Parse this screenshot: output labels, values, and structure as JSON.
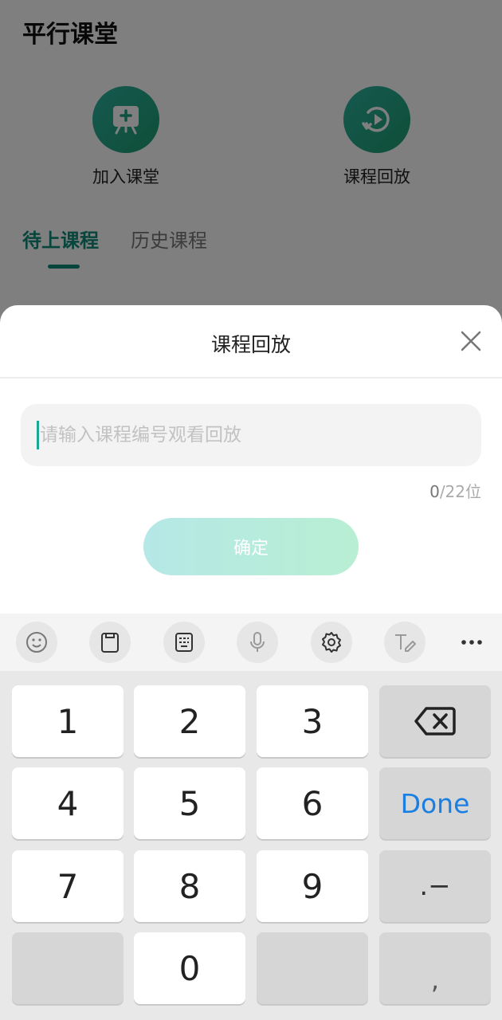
{
  "app": {
    "title": "平行课堂"
  },
  "actions": [
    {
      "label": "加入课堂",
      "icon": "join-class-icon"
    },
    {
      "label": "课程回放",
      "icon": "replay-icon"
    }
  ],
  "tabs": [
    {
      "label": "待上课程",
      "active": true
    },
    {
      "label": "历史课程",
      "active": false
    }
  ],
  "sheet": {
    "title": "课程回放",
    "close_icon": "close-icon",
    "input": {
      "value": "",
      "placeholder": "请输入课程编号观看回放"
    },
    "counter": {
      "current": "0",
      "suffix": "/22位"
    },
    "confirm_label": "确定"
  },
  "keyboard": {
    "toolbar": [
      "emoji-icon",
      "clipboard-icon",
      "keyboard-layout-icon",
      "microphone-icon",
      "settings-icon",
      "handwriting-icon",
      "more-icon"
    ],
    "keys": {
      "k1": "1",
      "k2": "2",
      "k3": "3",
      "k4": "4",
      "k5": "5",
      "k6": "6",
      "k7": "7",
      "k8": "8",
      "k9": "9",
      "k0": "0",
      "done": "Done",
      "symbol": ".−",
      "comma": ","
    }
  },
  "colors": {
    "accent": "#0e8a7a",
    "done_blue": "#1a7fe0",
    "button_gradient_start": "#b5e8e6",
    "button_gradient_end": "#b8efd3"
  }
}
